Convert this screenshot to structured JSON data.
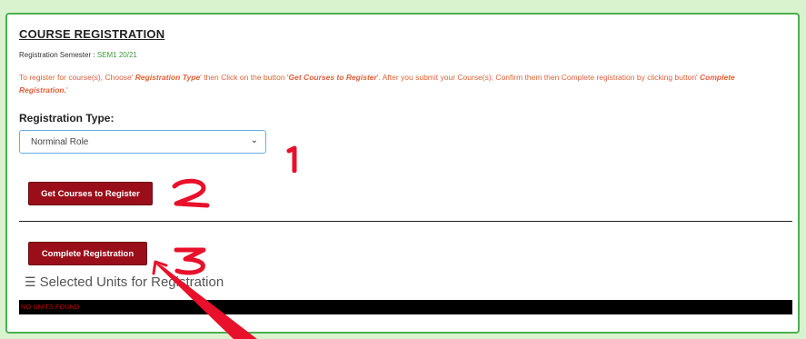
{
  "page": {
    "title": "COURSE REGISTRATION",
    "semester_label": "Registration Semester :",
    "semester_value": "SEM1 20/21",
    "instructions": {
      "p1": "To register for course(s), Choose' ",
      "em1": "Registration Type",
      "p2": "' then Click on the button '",
      "em2": "Get Courses to Register",
      "p3": "'. After you submit your Course(s), Confirm them then Complete registration by clicking button' ",
      "em3": "Complete Registration.",
      "p4": "'"
    },
    "registration_type_label": "Registration Type:",
    "registration_type_value": "Norminal Role",
    "get_courses_button": "Get Courses to Register",
    "complete_registration_button": "Complete Registration",
    "selected_units_heading": "Selected Units for Registration",
    "no_units_text": "NO UNITS FOUND"
  },
  "annotations": {
    "step1": "1",
    "step2": "2",
    "step3": "3",
    "color": "#e8102a"
  },
  "colors": {
    "background": "#d9f3cf",
    "border": "#4caf50",
    "button": "#9a0e1a",
    "instruction_text": "#e0603a"
  }
}
